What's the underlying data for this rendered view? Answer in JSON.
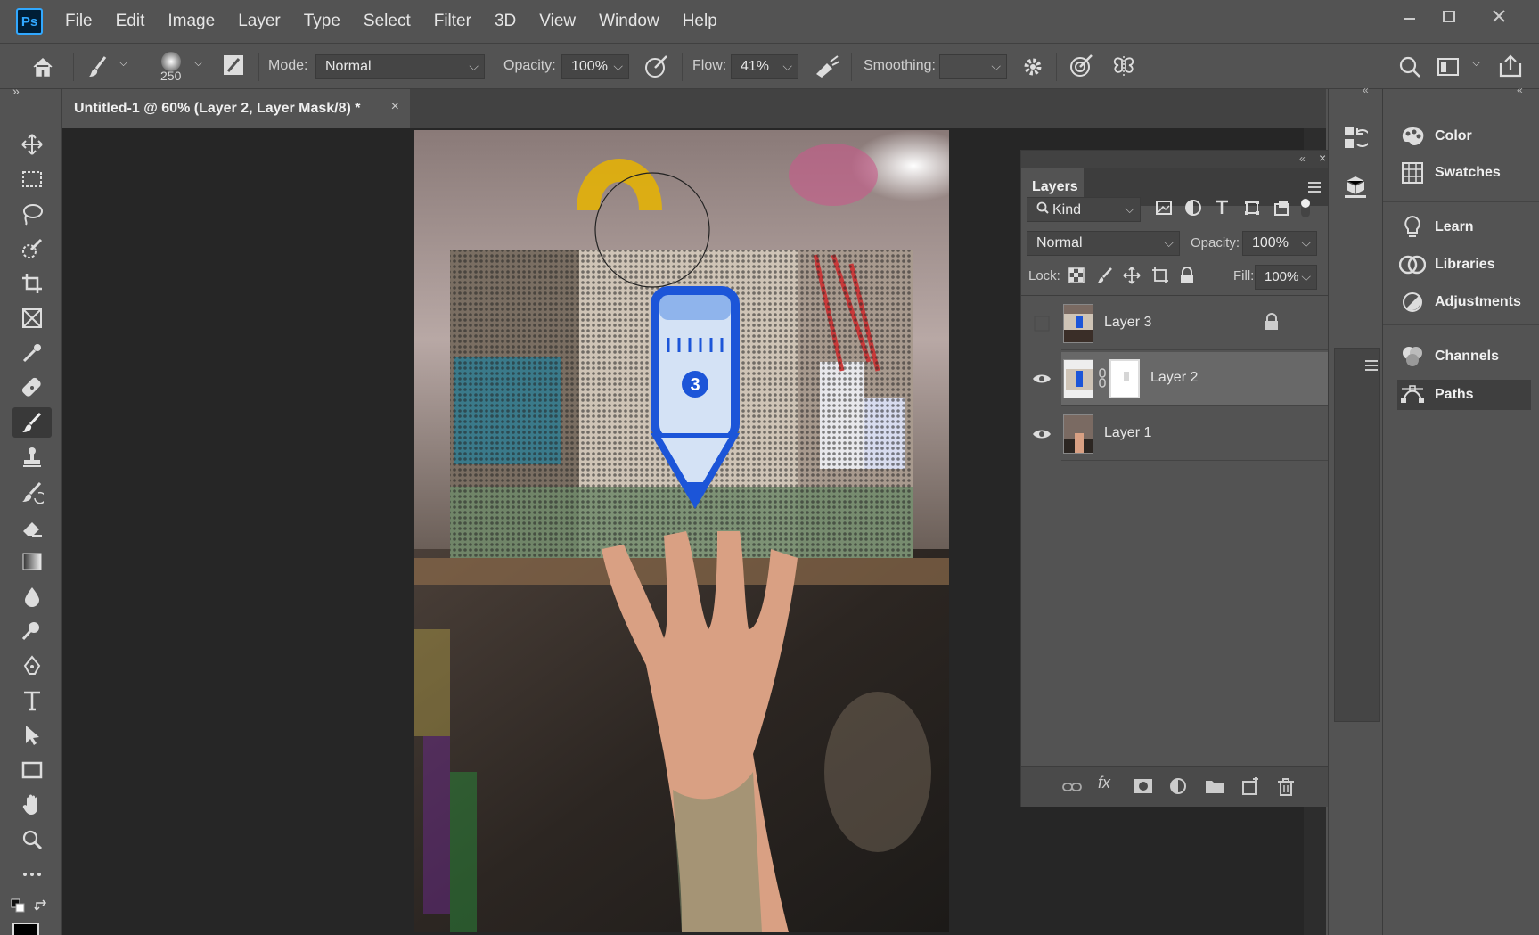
{
  "app": {
    "logo": "Ps"
  },
  "menu": [
    "File",
    "Edit",
    "Image",
    "Layer",
    "Type",
    "Select",
    "Filter",
    "3D",
    "View",
    "Window",
    "Help"
  ],
  "window_controls": {
    "minimize": "minimize-icon",
    "maximize": "maximize-icon",
    "close": "close-icon"
  },
  "options": {
    "brush_size": "250",
    "mode_label": "Mode:",
    "mode_value": "Normal",
    "opacity_label": "Opacity:",
    "opacity_value": "100%",
    "flow_label": "Flow:",
    "flow_value": "41%",
    "smoothing_label": "Smoothing:",
    "smoothing_value": ""
  },
  "document": {
    "tab_title": "Untitled-1 @ 60% (Layer 2, Layer Mask/8) *",
    "close_glyph": "×"
  },
  "tools": [
    "move",
    "marquee",
    "lasso",
    "quick-selection",
    "crop",
    "frame",
    "eyedropper",
    "healing-brush",
    "brush",
    "clone-stamp",
    "history-brush",
    "eraser",
    "gradient",
    "blur",
    "dodge",
    "pen",
    "type",
    "path-selection",
    "rectangle",
    "hand",
    "zoom",
    "more"
  ],
  "active_tool": "brush",
  "right_panels": {
    "items": [
      {
        "label": "Color",
        "icon": "color-icon"
      },
      {
        "label": "Swatches",
        "icon": "swatches-icon"
      },
      {
        "label": "Learn",
        "icon": "learn-icon"
      },
      {
        "label": "Libraries",
        "icon": "libraries-icon"
      },
      {
        "label": "Adjustments",
        "icon": "adjustments-icon"
      },
      {
        "label": "Channels",
        "icon": "channels-icon"
      },
      {
        "label": "Paths",
        "icon": "paths-icon"
      }
    ],
    "active": "Paths"
  },
  "layers_panel": {
    "title": "Layers",
    "filter_label": "Kind",
    "blend_mode": "Normal",
    "opacity_label": "Opacity:",
    "opacity_value": "100%",
    "lock_label": "Lock:",
    "fill_label": "Fill:",
    "fill_value": "100%",
    "layers": [
      {
        "name": "Layer 3",
        "visible": false,
        "locked": true,
        "selected": false
      },
      {
        "name": "Layer 2",
        "visible": true,
        "locked": false,
        "selected": true,
        "has_mask": true
      },
      {
        "name": "Layer 1",
        "visible": true,
        "locked": false,
        "selected": false
      }
    ]
  },
  "colors": {
    "accent": "#31a8ff",
    "ui_bg": "#535353",
    "canvas_bg": "#262626"
  }
}
